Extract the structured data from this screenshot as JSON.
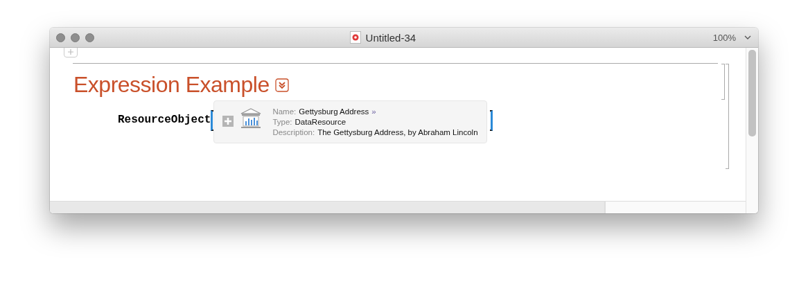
{
  "window": {
    "title": "Untitled-34",
    "zoom": "100%"
  },
  "heading": "Expression Example",
  "expression": {
    "head": "ResourceObject",
    "summary": {
      "fields": [
        {
          "label": "Name:",
          "value": "Gettysburg Address",
          "link": "»"
        },
        {
          "label": "Type:",
          "value": "DataResource"
        },
        {
          "label": "Description:",
          "value": "The Gettysburg Address, by Abraham Lincoln"
        }
      ]
    }
  }
}
